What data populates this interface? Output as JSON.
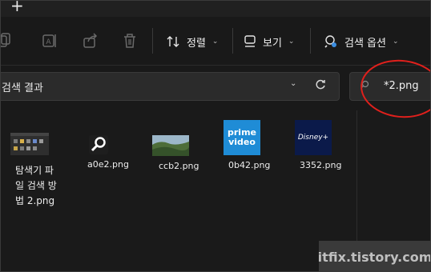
{
  "tab_add": "+",
  "toolbar": {
    "sort_label": "정렬",
    "view_label": "보기",
    "search_options_label": "검색 옵션",
    "chevron": "⌄"
  },
  "address": {
    "text": "검색 결과",
    "chevron": "⌄"
  },
  "search": {
    "query": "*2.png"
  },
  "files": [
    {
      "name": "탐색기 파일 검색 방법 2.png"
    },
    {
      "name": "a0e2.png"
    },
    {
      "name": "ccb2.png"
    },
    {
      "name": "0b42.png"
    },
    {
      "name": "3352.png"
    }
  ],
  "thumb_text": {
    "prime_line1": "prime",
    "prime_line2": "video",
    "disney": "Disney+"
  },
  "watermark": "itfix.tistory.com"
}
